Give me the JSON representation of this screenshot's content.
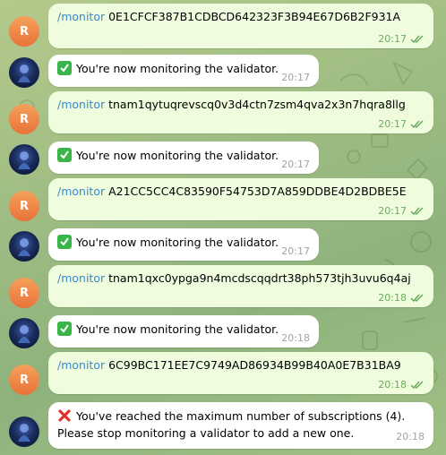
{
  "colors": {
    "outgoing_bubble": "#effdde",
    "incoming_bubble": "#ffffff",
    "command_link": "#3a89c9",
    "read_check": "#6eaa5e",
    "user_avatar": "#ef8545"
  },
  "user": {
    "avatar_letter": "R"
  },
  "messages": [
    {
      "direction": "out",
      "command": "/monitor",
      "text": " 0E1CFCF387B1CDBCD642323F3B94E67D6B2F931A",
      "time": "20:17",
      "status_icon": "double-check-icon"
    },
    {
      "direction": "in",
      "emoji": "check-mark-icon",
      "text": "You're now monitoring the validator.",
      "time": "20:17"
    },
    {
      "direction": "out",
      "command": "/monitor",
      "text": " tnam1qytuqrevscq0v3d4ctn7zsm4qva2x3n7hqra8llg",
      "time": "20:17",
      "status_icon": "double-check-icon"
    },
    {
      "direction": "in",
      "emoji": "check-mark-icon",
      "text": "You're now monitoring the validator.",
      "time": "20:17"
    },
    {
      "direction": "out",
      "command": "/monitor",
      "text": " A21CC5CC4C83590F54753D7A859DDBE4D2BDBE5E",
      "time": "20:17",
      "status_icon": "double-check-icon"
    },
    {
      "direction": "in",
      "emoji": "check-mark-icon",
      "text": "You're now monitoring the validator.",
      "time": "20:17"
    },
    {
      "direction": "out",
      "command": "/monitor",
      "text": " tnam1qxc0ypga9n4mcdscqqdrt38ph573tjh3uvu6q4aj",
      "time": "20:18",
      "status_icon": "double-check-icon"
    },
    {
      "direction": "in",
      "emoji": "check-mark-icon",
      "text": "You're now monitoring the validator.",
      "time": "20:18"
    },
    {
      "direction": "out",
      "command": "/monitor",
      "text": " 6C99BC171EE7C9749AD86934B99B40A0E7B31BA9",
      "time": "20:18",
      "status_icon": "double-check-icon"
    },
    {
      "direction": "in",
      "emoji": "cross-mark-icon",
      "text": "You've reached the maximum number of subscriptions (4).",
      "text2": "Please stop monitoring a validator to add a new one.",
      "time": "20:18"
    }
  ]
}
